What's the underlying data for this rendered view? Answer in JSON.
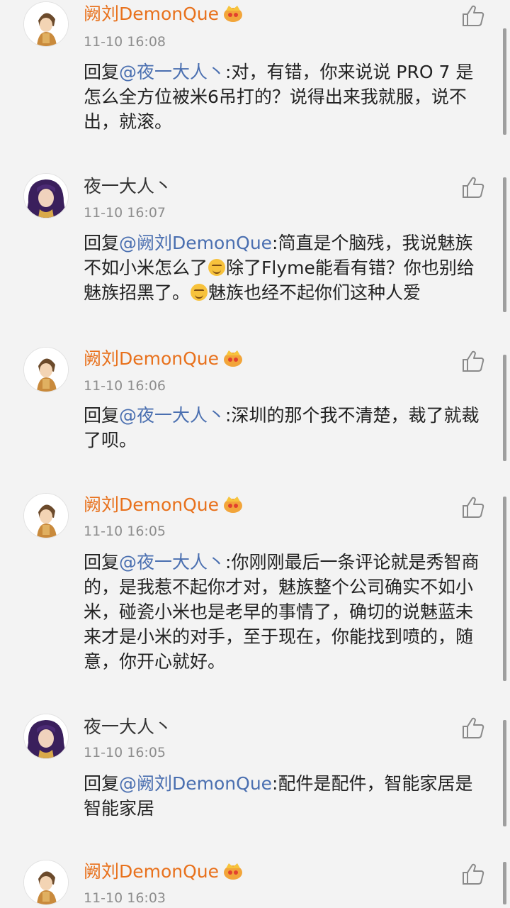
{
  "comments": [
    {
      "user": "阙刘DemonQue",
      "user_color": "orange",
      "badge": "vip-crown-icon",
      "avatar": "anime-boy-avatar",
      "time": "11-10 16:08",
      "reply_prefix": "回复",
      "mention": "@夜一大人丶",
      "text_parts": [
        ":对，有错，你来说说 PRO 7 是怎么全方位被米6吊打的？说得出来我就服，说不出，就滚。"
      ]
    },
    {
      "user": "夜一大人丶",
      "user_color": "dark",
      "avatar": "purple-hair-girl-avatar",
      "time": "11-10 16:07",
      "reply_prefix": "回复",
      "mention": "@阙刘DemonQue",
      "text_parts": [
        ":简直是个脑残，我说魅族不如小米怎么了",
        "除了Flyme能看有错？你也别给魅族招黑了。",
        "魅族也经不起你们这种人爱"
      ]
    },
    {
      "user": "阙刘DemonQue",
      "user_color": "orange",
      "badge": "vip-crown-icon",
      "avatar": "anime-boy-avatar",
      "time": "11-10 16:06",
      "reply_prefix": "回复",
      "mention": "@夜一大人丶",
      "text_parts": [
        ":深圳的那个我不清楚，裁了就裁了呗。"
      ]
    },
    {
      "user": "阙刘DemonQue",
      "user_color": "orange",
      "badge": "vip-crown-icon",
      "avatar": "anime-boy-avatar",
      "time": "11-10 16:05",
      "reply_prefix": "回复",
      "mention": "@夜一大人丶",
      "text_parts": [
        ":你刚刚最后一条评论就是秀智商的，是我惹不起你才对，魅族整个公司确实不如小米，碰瓷小米也是老早的事情了，确切的说魅蓝未来才是小米的对手，至于现在，你能找到喷的，随意，你开心就好。"
      ]
    },
    {
      "user": "夜一大人丶",
      "user_color": "dark",
      "avatar": "purple-hair-girl-avatar",
      "time": "11-10 16:05",
      "reply_prefix": "回复",
      "mention": "@阙刘DemonQue",
      "text_parts": [
        ":配件是配件，智能家居是智能家居"
      ]
    },
    {
      "user": "阙刘DemonQue",
      "user_color": "orange",
      "badge": "vip-crown-icon",
      "avatar": "anime-boy-avatar",
      "time": "11-10 16:03",
      "reply_prefix": "",
      "mention": "",
      "text_parts": []
    }
  ],
  "icons": {
    "like": "thumbs-up-icon",
    "emoji": "grin-sweat-emoji-icon"
  },
  "colors": {
    "username_orange": "#e8711c",
    "mention_blue": "#4a6fb0",
    "time_gray": "#8d8d8d",
    "background": "#f3f3f3"
  }
}
